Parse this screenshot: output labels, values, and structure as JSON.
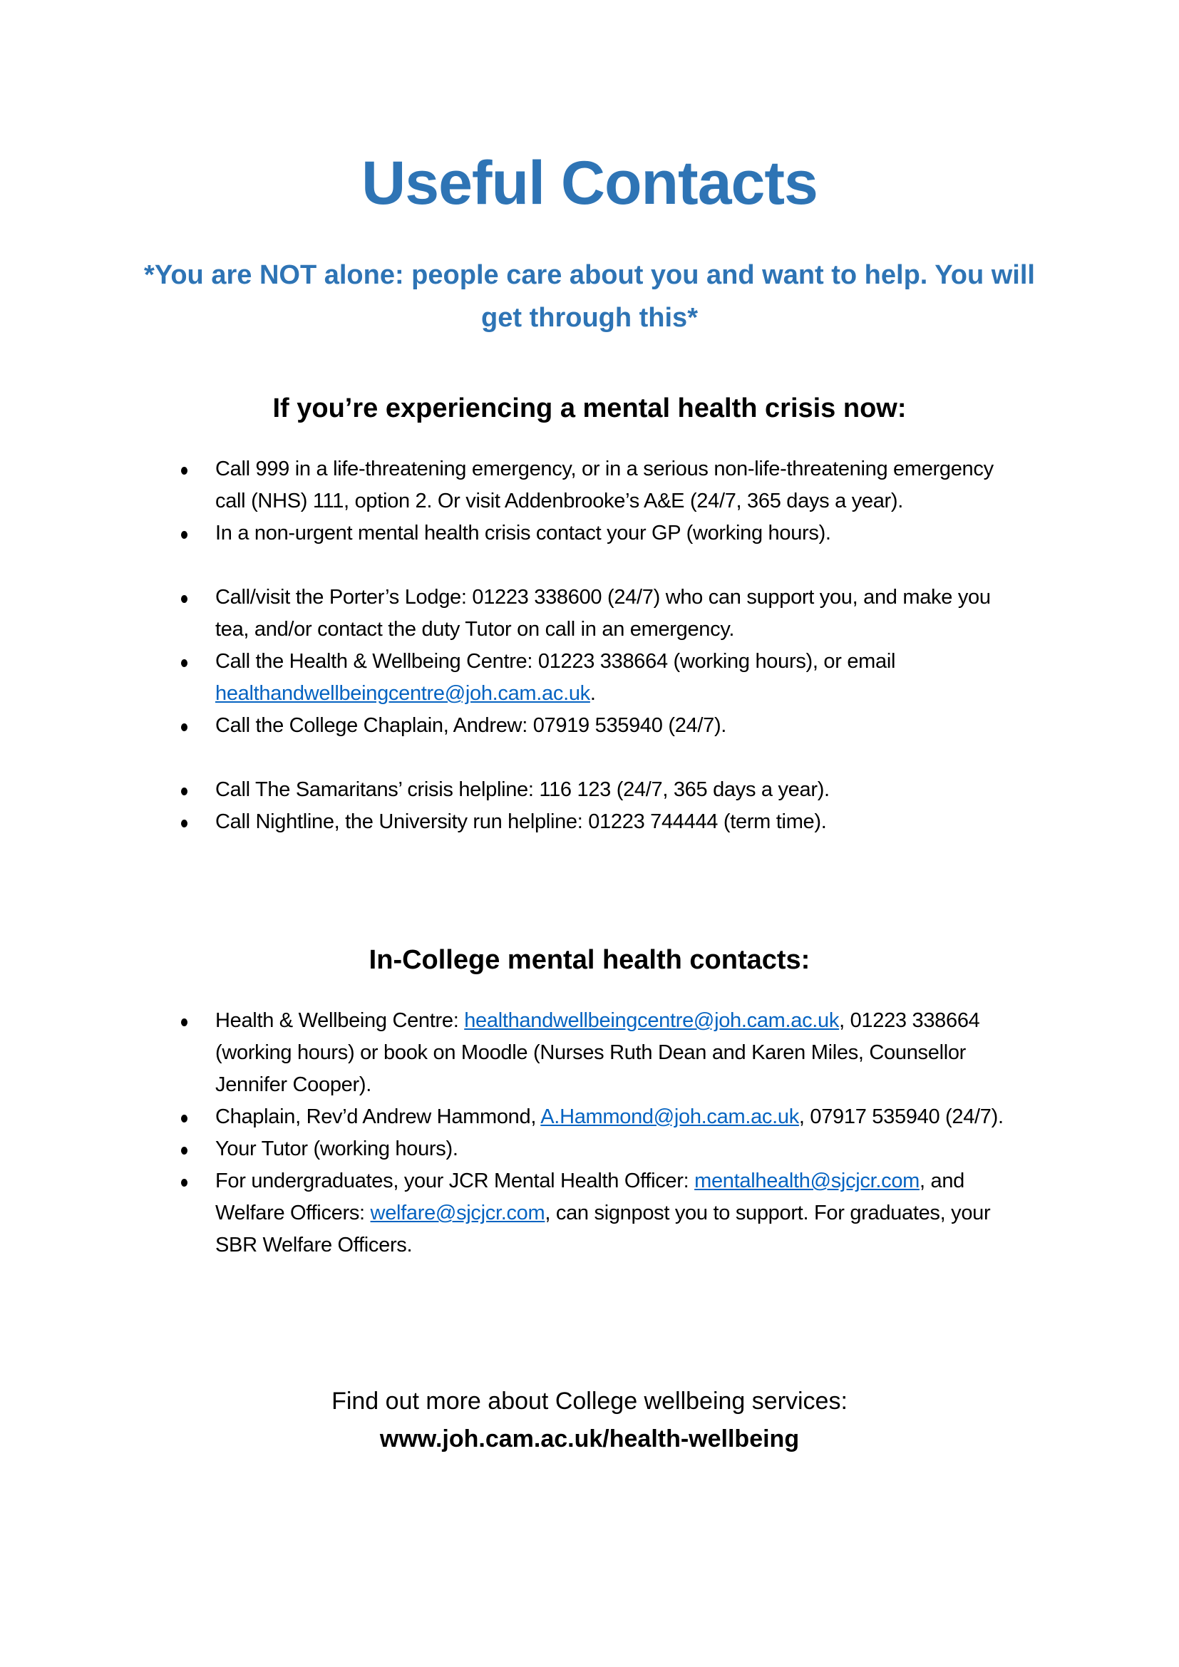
{
  "document": {
    "title": "Useful Contacts",
    "subtitle": "*You are NOT alone: people care about you and want to help. You will get through this*",
    "accent_color": "#2e74b5",
    "link_color": "#0563c1"
  },
  "crisis_section": {
    "heading": "If you’re experiencing a mental health crisis now:",
    "items": [
      {
        "gap": false,
        "segments": [
          {
            "text": "Call 999 in a life-threatening emergency, or in a serious non-life-threatening emergency call (NHS) 111, option 2. Or visit Addenbrooke’s A&E (24/7, 365 days a year)."
          }
        ]
      },
      {
        "gap": false,
        "segments": [
          {
            "text": "In a non-urgent mental health crisis contact your GP (working hours)."
          }
        ]
      },
      {
        "gap": true,
        "segments": [
          {
            "text": "Call/visit the Porter’s Lodge: 01223 338600 (24/7) who can support you, and make you tea, and/or contact the duty Tutor on call in an emergency."
          }
        ]
      },
      {
        "gap": false,
        "segments": [
          {
            "text": "Call the Health & Wellbeing Centre: 01223 338664 (working hours), or email "
          },
          {
            "text": "healthandwellbeingcentre@joh.cam.ac.uk",
            "link": true
          },
          {
            "text": "."
          }
        ]
      },
      {
        "gap": false,
        "segments": [
          {
            "text": "Call the College Chaplain, Andrew: 07919 535940 (24/7)."
          }
        ]
      },
      {
        "gap": true,
        "segments": [
          {
            "text": "Call The Samaritans’ crisis helpline: 116 123 (24/7, 365 days a year)."
          }
        ]
      },
      {
        "gap": false,
        "segments": [
          {
            "text": "Call Nightline, the University run helpline: 01223 744444 (term time)."
          }
        ]
      }
    ]
  },
  "college_section": {
    "heading": "In-College mental health contacts:",
    "items": [
      {
        "gap": false,
        "segments": [
          {
            "text": "Health & Wellbeing Centre: "
          },
          {
            "text": "healthandwellbeingcentre@joh.cam.ac.uk",
            "link": true
          },
          {
            "text": ", 01223 338664 (working hours) or book on Moodle (Nurses Ruth Dean and Karen Miles, Counsellor Jennifer Cooper)."
          }
        ]
      },
      {
        "gap": false,
        "segments": [
          {
            "text": "Chaplain, Rev’d Andrew Hammond, "
          },
          {
            "text": "A.Hammond@joh.cam.ac.uk",
            "link": true
          },
          {
            "text": ", 07917 535940 (24/7)."
          }
        ]
      },
      {
        "gap": false,
        "segments": [
          {
            "text": "Your Tutor (working hours)."
          }
        ]
      },
      {
        "gap": false,
        "segments": [
          {
            "text": "For undergraduates, your JCR Mental Health Officer: "
          },
          {
            "text": "mentalhealth@sjcjcr.com",
            "link": true
          },
          {
            "text": ", and Welfare Officers: "
          },
          {
            "text": "welfare@sjcjcr.com",
            "link": true
          },
          {
            "text": ", can signpost you to support. For graduates, your SBR Welfare Officers."
          }
        ]
      }
    ]
  },
  "footer": {
    "intro": "Find out more about College wellbeing services:",
    "url": "www.joh.cam.ac.uk/health-wellbeing"
  }
}
